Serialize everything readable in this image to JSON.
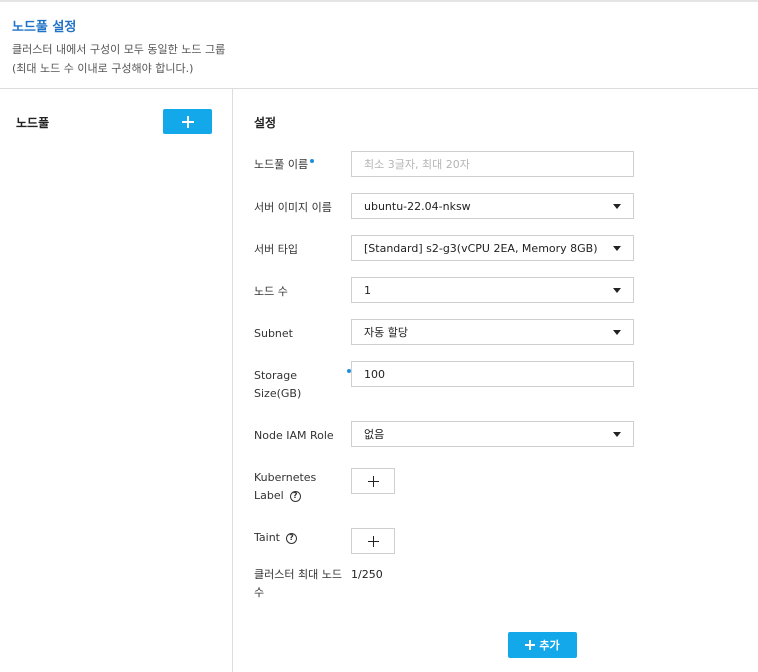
{
  "header": {
    "title": "노드풀 설정",
    "desc_line1": "클러스터 내에서 구성이 모두 동일한 노드 그룹",
    "desc_line2": "(최대 노드 수 이내로 구성해야 합니다.)"
  },
  "left": {
    "title": "노드풀"
  },
  "settings": {
    "title": "설정",
    "nodepool_name": {
      "label": "노드풀 이름",
      "placeholder": "최소 3글자, 최대 20자",
      "value": ""
    },
    "server_image": {
      "label": "서버 이미지 이름",
      "value": "ubuntu-22.04-nksw"
    },
    "server_type": {
      "label": "서버 타입",
      "value": "[Standard] s2-g3(vCPU 2EA, Memory 8GB)"
    },
    "node_count": {
      "label": "노드 수",
      "value": "1"
    },
    "subnet": {
      "label": "Subnet",
      "value": "자동 할당"
    },
    "storage": {
      "label_line1": "Storage",
      "label_line2": "Size(GB)",
      "value": "100"
    },
    "iam_role": {
      "label": "Node IAM Role",
      "value": "없음"
    },
    "k8s_label": {
      "label_line1": "Kubernetes",
      "label_line2": "Label"
    },
    "taint": {
      "label": "Taint"
    },
    "max_nodes": {
      "label_line1": "클러스터 최대 노드",
      "label_line2": "수",
      "value": "1/250"
    },
    "submit_label": "추가"
  },
  "colors": {
    "accent": "#12a8ea",
    "title_blue": "#1f73c7",
    "required_dot": "#1f8fe0"
  }
}
